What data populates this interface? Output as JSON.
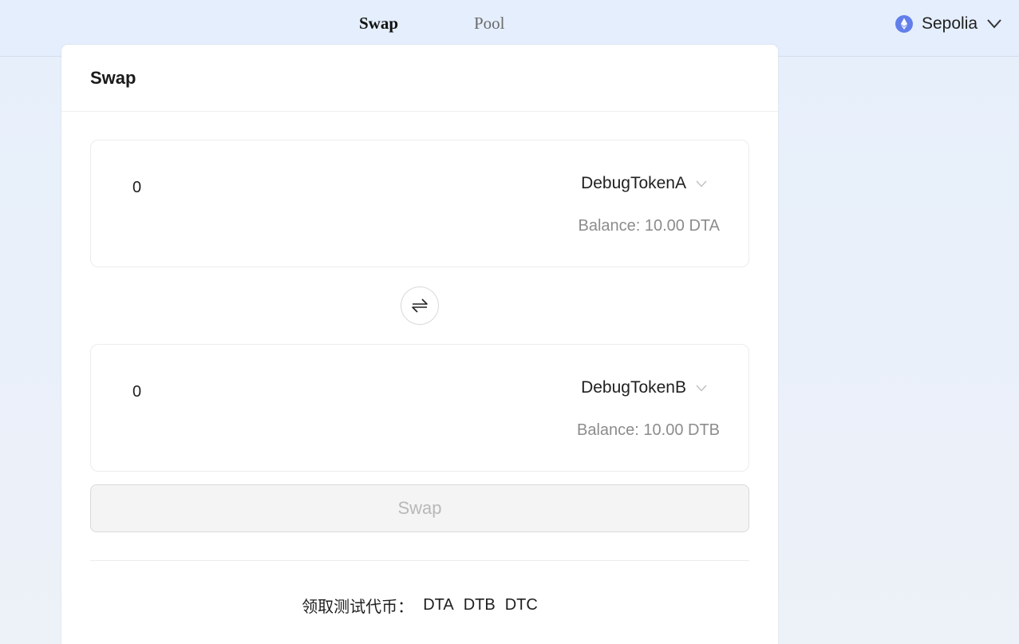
{
  "nav": {
    "items": [
      {
        "label": "Swap",
        "active": true
      },
      {
        "label": "Pool",
        "active": false
      }
    ],
    "network": {
      "label": "Sepolia",
      "icon": "ethereum-icon"
    }
  },
  "card": {
    "title": "Swap",
    "from": {
      "amount": "0",
      "token": "DebugTokenA",
      "balance": "Balance: 10.00 DTA"
    },
    "to": {
      "amount": "0",
      "token": "DebugTokenB",
      "balance": "Balance: 10.00 DTB"
    },
    "switch_icon": "swap-arrows-icon",
    "swap_button": "Swap",
    "faucet": {
      "label": "领取测试代币：",
      "links": [
        "DTA",
        "DTB",
        "DTC"
      ]
    }
  },
  "colors": {
    "accent": "#627eea",
    "page_bg": "#e6effb",
    "disabled_text": "#b8b8b8"
  }
}
